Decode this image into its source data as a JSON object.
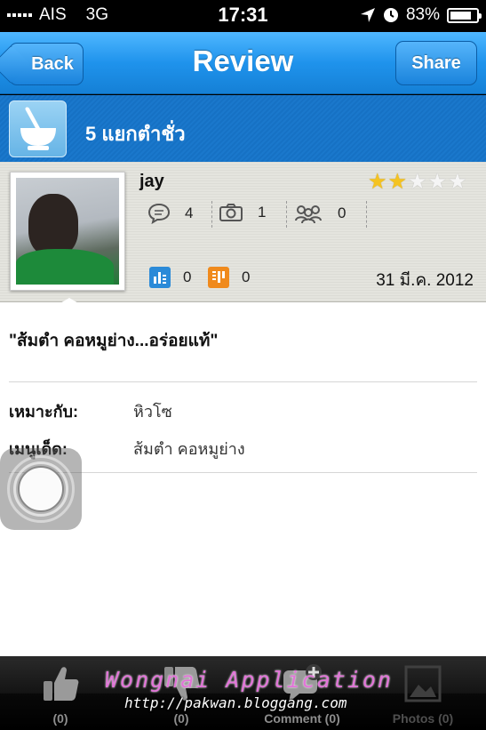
{
  "status_bar": {
    "carrier": "AIS",
    "network": "3G",
    "time": "17:31",
    "battery": "83%",
    "battery_level": 0.83
  },
  "nav": {
    "back_label": "Back",
    "title": "Review",
    "share_label": "Share"
  },
  "category": {
    "icon": "mortar-pestle-icon",
    "label": "5 แยกตำชั่ว"
  },
  "reviewer": {
    "name": "jay",
    "rating": 2,
    "rating_max": 5,
    "comments_count": "4",
    "photos_count": "1",
    "friends_count": "0",
    "likes_count": "0",
    "dislikes_count": "0",
    "date": "31 มี.ค. 2012"
  },
  "review": {
    "quote": "\"ส้มตำ คอหมูย่าง...อร่อยแท้\"",
    "fields": [
      {
        "label": "เหมาะกับ:",
        "value": "หิวโซ"
      },
      {
        "label": "เมนูเด็ด:",
        "value": "ส้มตำ คอหมูย่าง"
      }
    ]
  },
  "tabs": [
    {
      "label": "(0)",
      "icon": "thumbs-up-icon"
    },
    {
      "label": "(0)",
      "icon": "thumbs-down-icon"
    },
    {
      "label": "Comment (0)",
      "icon": "comment-add-icon"
    },
    {
      "label": "Photos (0)",
      "icon": "photo-icon"
    }
  ],
  "watermark": {
    "title": "Wongnai Application",
    "url": "http://pakwan.bloggang.com"
  },
  "colors": {
    "nav_blue": "#1f93ec",
    "category_blue": "#1671c4",
    "star_gold": "#f4c321",
    "vote_blue": "#2a8ad8",
    "vote_orange": "#f08a1c",
    "watermark_pink": "#e274d8"
  }
}
